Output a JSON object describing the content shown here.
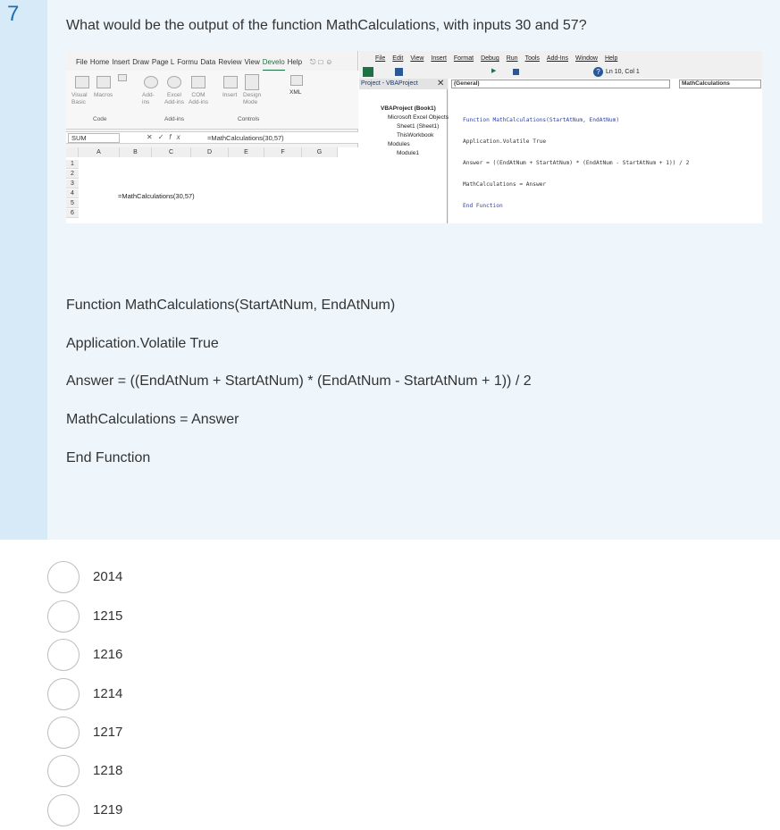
{
  "question": {
    "number": "7",
    "prompt": "What would be the output of the function MathCalculations, with inputs 30 and 57?"
  },
  "excel": {
    "tabs": [
      "File",
      "Home",
      "Insert",
      "Draw",
      "Page L",
      "Formu",
      "Data",
      "Review",
      "View",
      "Develo",
      "Help"
    ],
    "active_tab": "Develo",
    "ribbon": {
      "visual_basic": "Visual Basic",
      "macros": "Macros",
      "add_ins": "Add-ins",
      "excel_add_ins": "Excel Add-ins",
      "com_add_ins": "COM Add-ins",
      "insert": "Insert",
      "design_mode": "Design Mode",
      "xml": "XML",
      "group_code": "Code",
      "group_addins": "Add-ins",
      "group_controls": "Controls"
    },
    "name_box": "SUM",
    "formula": "=MathCalculations(30,57)",
    "columns": [
      "A",
      "B",
      "C",
      "D",
      "E",
      "F",
      "G"
    ],
    "rows": [
      "1",
      "2",
      "3",
      "4",
      "5",
      "6"
    ],
    "cell_c4": "=MathCalculations(30,57)"
  },
  "vbe": {
    "menu": [
      "File",
      "Edit",
      "View",
      "Insert",
      "Format",
      "Debug",
      "Run",
      "Tools",
      "Add-Ins",
      "Window",
      "Help"
    ],
    "status": "Ln 10, Col 1",
    "project_title": "Project - VBAProject",
    "tree": [
      "VBAProject (Book1)",
      "Microsoft Excel Objects",
      "Sheet1 (Sheet1)",
      "ThisWorkbook",
      "Modules",
      "Module1"
    ],
    "general": "(General)",
    "proc": "MathCalculations",
    "code_lines": [
      "Function MathCalculations(StartAtNum, EndAtNum)",
      "Application.Volatile True",
      "Answer = ((EndAtNum + StartAtNum) * (EndAtNum - StartAtNum + 1)) / 2",
      "MathCalculations = Answer",
      "End Function"
    ]
  },
  "code": [
    "Function MathCalculations(StartAtNum, EndAtNum)",
    "Application.Volatile True",
    "Answer = ((EndAtNum + StartAtNum) * (EndAtNum - StartAtNum + 1)) / 2",
    "MathCalculations = Answer",
    "End Function"
  ],
  "options": [
    "2014",
    "1215",
    "1216",
    "1214",
    "1217",
    "1218",
    "1219"
  ]
}
